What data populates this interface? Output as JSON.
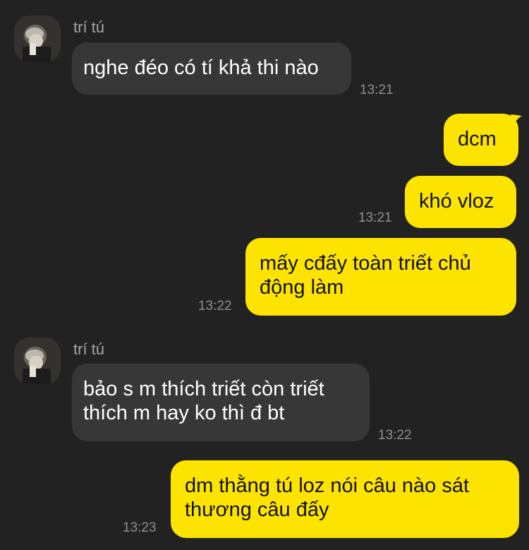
{
  "messages": [
    {
      "sender": "trí tú",
      "avatar": "user-avatar",
      "text": "nghe đéo có tí khả thi nào",
      "time": "13:21"
    },
    {
      "text": "dcm",
      "outgoing": true
    },
    {
      "text": "khó vloz",
      "time": "13:21",
      "outgoing": true
    },
    {
      "text": "mấy cđấy toàn triết chủ động làm",
      "time": "13:22",
      "outgoing": true
    },
    {
      "sender": "trí tú",
      "avatar": "user-avatar",
      "text": "bảo s m thích triết còn triết thích m hay ko thì đ bt",
      "time": "13:22"
    },
    {
      "text": "dm thằng tú loz nói câu nào sát thương câu đấy",
      "time": "13:23",
      "outgoing": true
    }
  ],
  "colors": {
    "background": "#222223",
    "incoming_bubble": "#373738",
    "outgoing_bubble": "#fde400",
    "timestamp": "#8e8e8e",
    "sender_name": "#a6a6a6"
  }
}
